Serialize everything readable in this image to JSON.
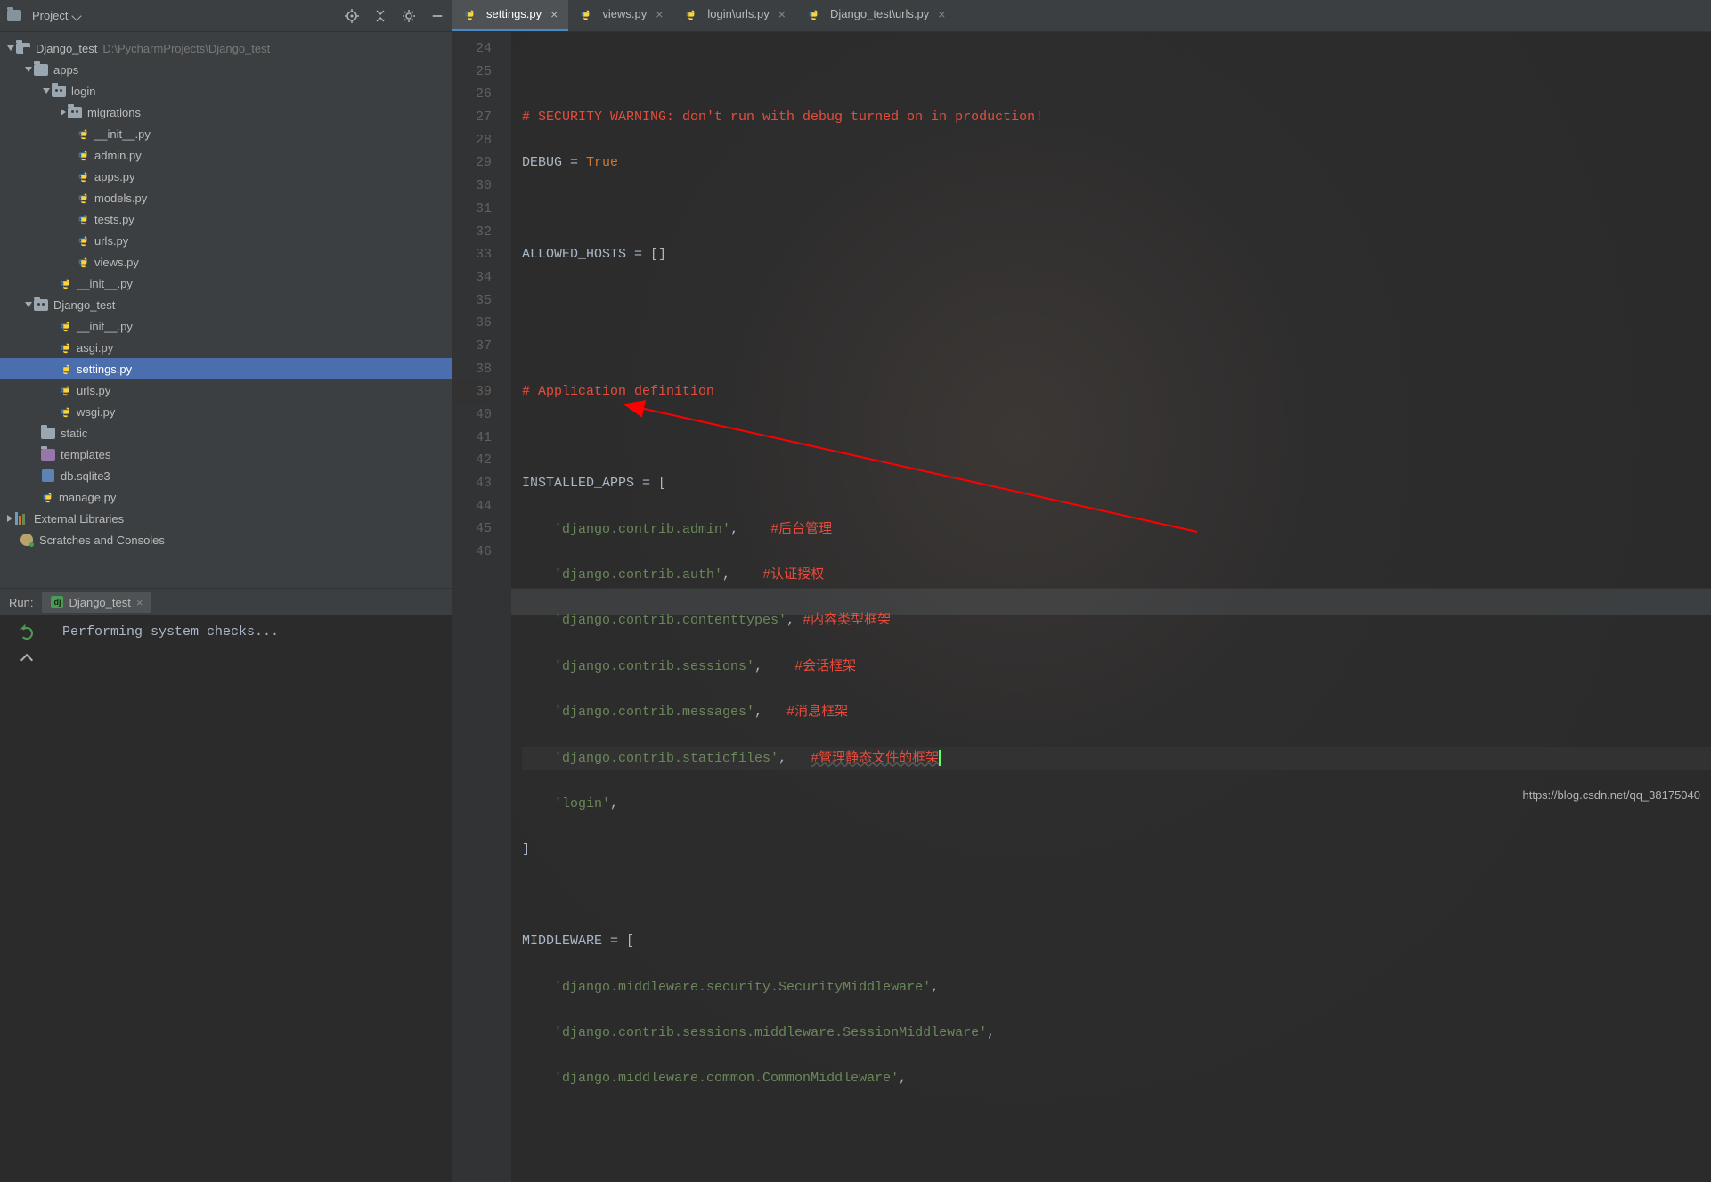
{
  "project_panel": {
    "title": "Project",
    "root_name": "Django_test",
    "root_path": "D:\\PycharmProjects\\Django_test",
    "tree": {
      "apps": "apps",
      "login": "login",
      "migrations": "migrations",
      "init": "__init__.py",
      "admin": "admin.py",
      "apps_py": "apps.py",
      "models": "models.py",
      "tests": "tests.py",
      "urls": "urls.py",
      "views": "views.py",
      "init2": "__init__.py",
      "django_test": "Django_test",
      "init3": "__init__.py",
      "asgi": "asgi.py",
      "settings": "settings.py",
      "urls2": "urls.py",
      "wsgi": "wsgi.py",
      "static": "static",
      "templates": "templates",
      "db": "db.sqlite3",
      "manage": "manage.py",
      "ext_libs": "External Libraries",
      "scratches": "Scratches and Consoles"
    }
  },
  "tabs": [
    {
      "label": "settings.py",
      "active": true
    },
    {
      "label": "views.py",
      "active": false
    },
    {
      "label": "login\\urls.py",
      "active": false
    },
    {
      "label": "Django_test\\urls.py",
      "active": false
    }
  ],
  "editor": {
    "lines_start": 24,
    "lines_end": 46,
    "code": {
      "l25": "# SECURITY WARNING: don't run with debug turned on in production!",
      "l26a": "DEBUG = ",
      "l26b": "True",
      "l28": "ALLOWED_HOSTS = []",
      "l31": "# Application definition",
      "l33": "INSTALLED_APPS = [",
      "l34a": "'django.contrib.admin'",
      "l34b": ",",
      "l34c": "#后台管理",
      "l35a": "'django.contrib.auth'",
      "l35b": ",",
      "l35c": "#认证授权",
      "l36a": "'django.contrib.contenttypes'",
      "l36b": ",",
      "l36c": "#内容类型框架",
      "l37a": "'django.contrib.sessions'",
      "l37b": ",",
      "l37c": "#会话框架",
      "l38a": "'django.contrib.messages'",
      "l38b": ",",
      "l38c": "#消息框架",
      "l39a": "'django.contrib.staticfiles'",
      "l39b": ",",
      "l39c": "#管理静态文件的框架",
      "l40a": "'login'",
      "l40b": ",",
      "l41": "]",
      "l43": "MIDDLEWARE = [",
      "l44a": "'django.middleware.security.SecurityMiddleware'",
      "l44b": ",",
      "l45a": "'django.contrib.sessions.middleware.SessionMiddleware'",
      "l45b": ",",
      "l46a": "'django.middleware.common.CommonMiddleware'",
      "l46b": ","
    }
  },
  "run": {
    "label": "Run:",
    "tab": "Django_test",
    "output": "Performing system checks..."
  },
  "watermark": "https://blog.csdn.net/qq_38175040",
  "misc": {
    "dj": "dj"
  }
}
